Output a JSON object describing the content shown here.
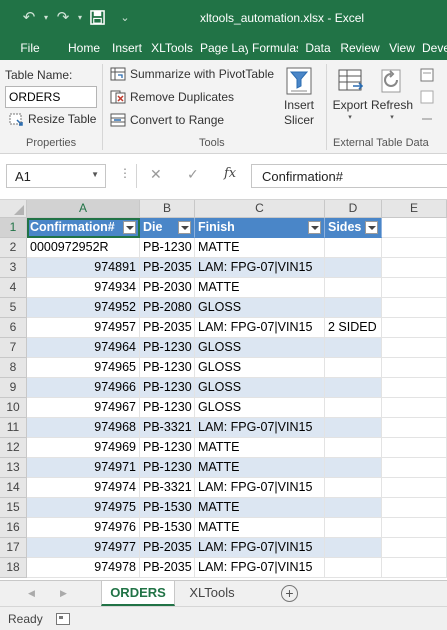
{
  "window": {
    "title": "xltools_automation.xlsx - Excel"
  },
  "quick_access": {
    "undo_icon": "undo-icon",
    "redo_icon": "redo-icon",
    "save_icon": "save-icon",
    "customize_icon": "chevron-down-icon"
  },
  "ribbon_tabs": [
    "File",
    "Home",
    "Insert",
    "XLTools",
    "Page Layout",
    "Formulas",
    "Data",
    "Review",
    "View",
    "Developer"
  ],
  "ribbon": {
    "properties": {
      "table_name_label": "Table Name:",
      "table_name_value": "ORDERS",
      "resize_table": "Resize Table",
      "group_label": "Properties"
    },
    "tools": {
      "summarize": "Summarize with PivotTable",
      "remove_duplicates": "Remove Duplicates",
      "convert_range": "Convert to Range",
      "insert_slicer_line1": "Insert",
      "insert_slicer_line2": "Slicer",
      "group_label": "Tools"
    },
    "external": {
      "export": "Export",
      "refresh": "Refresh",
      "group_label": "External Table Data"
    }
  },
  "formula_bar": {
    "name_box": "A1",
    "cancel": "✕",
    "enter": "✓",
    "fx": "fx",
    "content": "Confirmation#"
  },
  "grid": {
    "columns": [
      "A",
      "B",
      "C",
      "D",
      "E"
    ],
    "headers": [
      "Confirmation#",
      "Die",
      "Finish",
      "Sides"
    ],
    "rows": [
      {
        "n": "1"
      },
      {
        "n": "2",
        "a": "0000972952R",
        "b": "PB-1230",
        "c": "MATTE",
        "d": ""
      },
      {
        "n": "3",
        "a": "974891",
        "b": "PB-2035",
        "c": "LAM: FPG-07|VIN15",
        "d": ""
      },
      {
        "n": "4",
        "a": "974934",
        "b": "PB-2030",
        "c": "MATTE",
        "d": ""
      },
      {
        "n": "5",
        "a": "974952",
        "b": "PB-2080",
        "c": "GLOSS",
        "d": ""
      },
      {
        "n": "6",
        "a": "974957",
        "b": "PB-2035",
        "c": "LAM: FPG-07|VIN15",
        "d": "2 SIDED"
      },
      {
        "n": "7",
        "a": "974964",
        "b": "PB-1230",
        "c": "GLOSS",
        "d": ""
      },
      {
        "n": "8",
        "a": "974965",
        "b": "PB-1230",
        "c": "GLOSS",
        "d": ""
      },
      {
        "n": "9",
        "a": "974966",
        "b": "PB-1230",
        "c": "GLOSS",
        "d": ""
      },
      {
        "n": "10",
        "a": "974967",
        "b": "PB-1230",
        "c": "GLOSS",
        "d": ""
      },
      {
        "n": "11",
        "a": "974968",
        "b": "PB-3321",
        "c": "LAM: FPG-07|VIN15",
        "d": ""
      },
      {
        "n": "12",
        "a": "974969",
        "b": "PB-1230",
        "c": "MATTE",
        "d": ""
      },
      {
        "n": "13",
        "a": "974971",
        "b": "PB-1230",
        "c": "MATTE",
        "d": ""
      },
      {
        "n": "14",
        "a": "974974",
        "b": "PB-3321",
        "c": "LAM: FPG-07|VIN15",
        "d": ""
      },
      {
        "n": "15",
        "a": "974975",
        "b": "PB-1530",
        "c": "MATTE",
        "d": ""
      },
      {
        "n": "16",
        "a": "974976",
        "b": "PB-1530",
        "c": "MATTE",
        "d": ""
      },
      {
        "n": "17",
        "a": "974977",
        "b": "PB-2035",
        "c": "LAM: FPG-07|VIN15",
        "d": ""
      },
      {
        "n": "18",
        "a": "974978",
        "b": "PB-2035",
        "c": "LAM: FPG-07|VIN15",
        "d": ""
      }
    ]
  },
  "sheet_tabs": [
    "ORDERS",
    "XLTools"
  ],
  "active_sheet": "ORDERS",
  "status": {
    "text": "Ready"
  },
  "colors": {
    "excel_green": "#217346",
    "table_header": "#4a86c8",
    "table_band": "#dce6f2"
  }
}
